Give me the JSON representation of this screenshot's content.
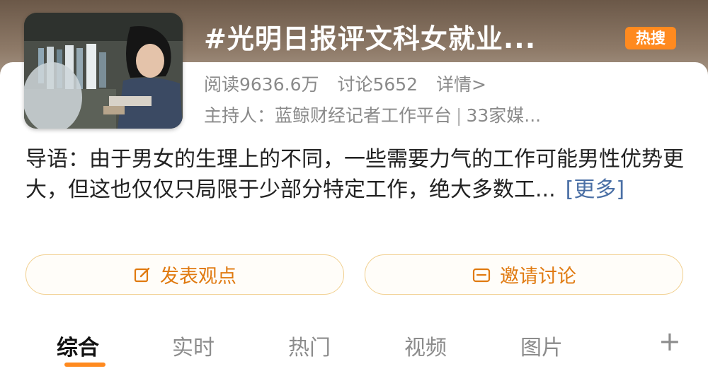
{
  "topic": {
    "title": "#光明日报评文科女就业...",
    "badge": "热搜",
    "reads": "阅读9636.6万",
    "discussions": "讨论5652",
    "details_link": "详情>",
    "host_label": "主持人：",
    "host_name": "蓝鲸财经记者工作平台",
    "host_separator": "|",
    "media_count": "33家媒..."
  },
  "intro": {
    "text": "导语：由于男女的生理上的不同，一些需要力气的工作可能男性优势更大，但这也仅仅只局限于少部分特定工作，绝大多数工...",
    "more_link": "[更多]"
  },
  "actions": {
    "post_label": "发表观点",
    "invite_label": "邀请讨论"
  },
  "tabs": [
    "综合",
    "实时",
    "热门",
    "视频",
    "图片"
  ],
  "active_tab": "综合",
  "colors": {
    "accent": "#ff8a1f",
    "link": "#4a6fa5",
    "muted_text": "#8a8a8a",
    "pill_border": "#f1cf8e"
  },
  "icons": {
    "post": "edit-icon",
    "invite": "mail-icon",
    "add_tab": "plus-icon"
  }
}
